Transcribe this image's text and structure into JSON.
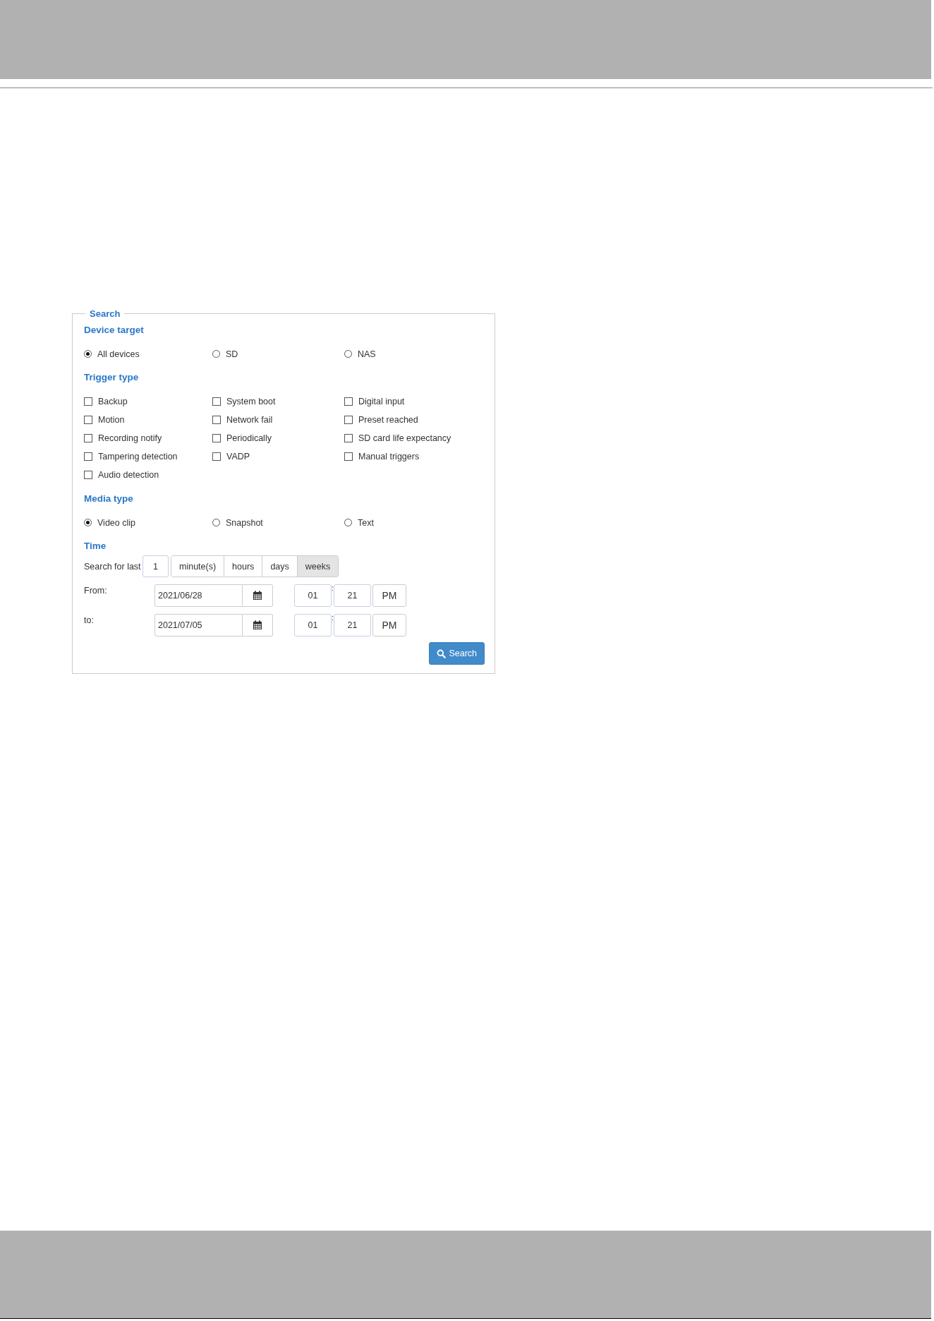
{
  "panel": {
    "legend": "Search"
  },
  "device_target": {
    "heading": "Device target",
    "options": [
      {
        "label": "All devices",
        "selected": true
      },
      {
        "label": "SD",
        "selected": false
      },
      {
        "label": "NAS",
        "selected": false
      }
    ]
  },
  "trigger_type": {
    "heading": "Trigger type",
    "options": [
      {
        "label": "Backup",
        "checked": false
      },
      {
        "label": "System boot",
        "checked": false
      },
      {
        "label": "Digital input",
        "checked": false
      },
      {
        "label": "Motion",
        "checked": false
      },
      {
        "label": "Network fail",
        "checked": false
      },
      {
        "label": "Preset reached",
        "checked": false
      },
      {
        "label": "Recording notify",
        "checked": false
      },
      {
        "label": "Periodically",
        "checked": false
      },
      {
        "label": "SD card life expectancy",
        "checked": false
      },
      {
        "label": "Tampering detection",
        "checked": false
      },
      {
        "label": "VADP",
        "checked": false
      },
      {
        "label": "Manual triggers",
        "checked": false
      },
      {
        "label": "Audio detection",
        "checked": false
      }
    ]
  },
  "media_type": {
    "heading": "Media type",
    "options": [
      {
        "label": "Video clip",
        "selected": true
      },
      {
        "label": "Snapshot",
        "selected": false
      },
      {
        "label": "Text",
        "selected": false
      }
    ]
  },
  "time": {
    "heading": "Time",
    "search_for_last_label": "Search for last",
    "amount": "1",
    "units": [
      {
        "label": "minute(s)",
        "selected": false
      },
      {
        "label": "hours",
        "selected": false
      },
      {
        "label": "days",
        "selected": false
      },
      {
        "label": "weeks",
        "selected": true
      }
    ],
    "ranges": [
      {
        "label": "From:",
        "date": "2021/06/28",
        "hour": "01",
        "separator": ":",
        "minute": "21",
        "ampm": "PM"
      },
      {
        "label": "to:",
        "date": "2021/07/05",
        "hour": "01",
        "separator": ":",
        "minute": "21",
        "ampm": "PM"
      }
    ]
  },
  "search_button": "Search"
}
